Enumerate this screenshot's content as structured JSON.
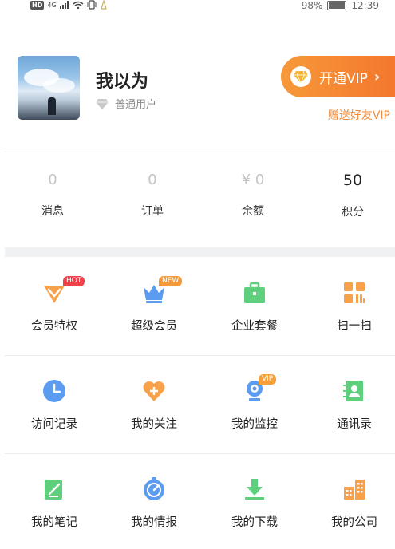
{
  "status_bar": {
    "network": "HD",
    "signal_text": "4G",
    "battery": "98%",
    "time": "12:39"
  },
  "profile": {
    "username": "我以为",
    "level": "普通用户",
    "vip_button_label": "开通VIP",
    "gift_vip": "赠送好友VIP"
  },
  "stats": [
    {
      "value": "0",
      "label": "消息"
    },
    {
      "value": "0",
      "label": "订单"
    },
    {
      "value": "¥ 0",
      "label": "余额"
    },
    {
      "value": "50",
      "label": "积分"
    }
  ],
  "grid": [
    [
      {
        "label": "会员特权",
        "icon": "member-privilege-icon",
        "tag": "HOT"
      },
      {
        "label": "超级会员",
        "icon": "crown-icon",
        "tag": "NEW"
      },
      {
        "label": "企业套餐",
        "icon": "briefcase-icon"
      },
      {
        "label": "扫一扫",
        "icon": "qr-scan-icon"
      }
    ],
    [
      {
        "label": "访问记录",
        "icon": "clock-icon"
      },
      {
        "label": "我的关注",
        "icon": "heart-plus-icon"
      },
      {
        "label": "我的监控",
        "icon": "webcam-icon",
        "tag": "VIP"
      },
      {
        "label": "通讯录",
        "icon": "contacts-icon"
      }
    ],
    [
      {
        "label": "我的笔记",
        "icon": "note-icon"
      },
      {
        "label": "我的情报",
        "icon": "compass-icon"
      },
      {
        "label": "我的下载",
        "icon": "download-icon"
      },
      {
        "label": "我的公司",
        "icon": "company-icon"
      }
    ]
  ],
  "colors": {
    "accent_orange": "#f4772d",
    "blue_icon": "#5b9bf0",
    "green_icon": "#5fcf7d",
    "orange_icon": "#f7a24a"
  }
}
